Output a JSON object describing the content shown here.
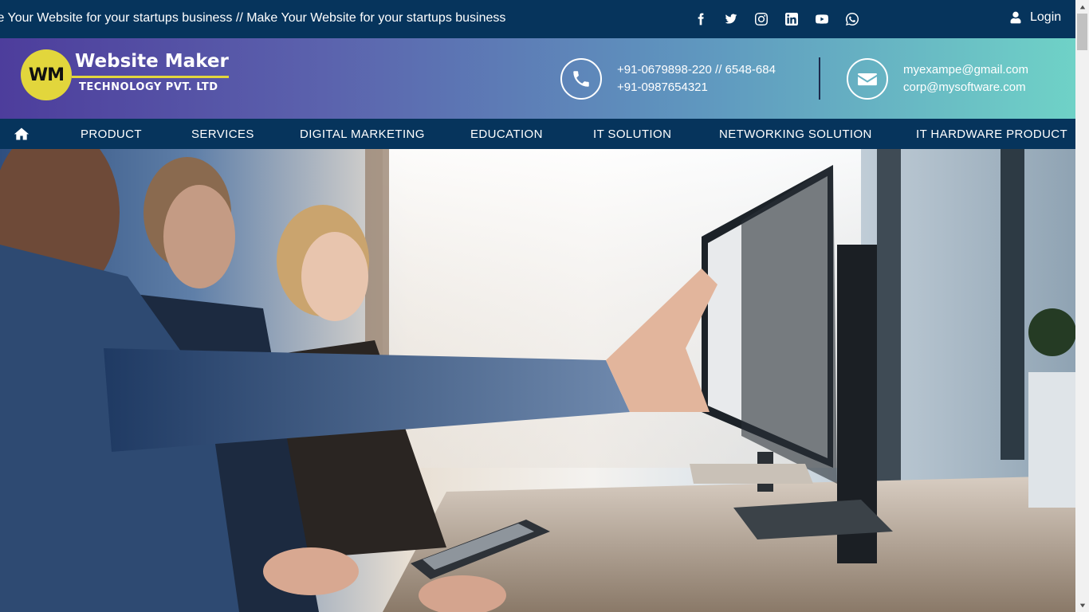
{
  "topbar": {
    "marquee": ":e Your Website for your startups business // Make Your Website for your startups business",
    "socials": [
      "facebook-icon",
      "twitter-icon",
      "instagram-icon",
      "linkedin-icon",
      "youtube-icon",
      "whatsapp-icon"
    ],
    "login_label": "Login"
  },
  "header": {
    "logo_initials": "WM",
    "logo_title": "Website Maker",
    "logo_subtitle": "TECHNOLOGY PVT. LTD",
    "phone_line1": "+91-0679898-220 // 6548-684",
    "phone_line2": "+91-0987654321",
    "email_line1": "myexampe@gmail.com",
    "email_line2": "corp@mysoftware.com"
  },
  "nav": {
    "items": [
      {
        "label": "PRODUCT"
      },
      {
        "label": "SERVICES"
      },
      {
        "label": "DIGITAL MARKETING"
      },
      {
        "label": "EDUCATION"
      },
      {
        "label": "IT SOLUTION"
      },
      {
        "label": "NETWORKING SOLUTION"
      },
      {
        "label": "IT HARDWARE PRODUCT"
      }
    ]
  },
  "colors": {
    "topbar_bg": "#06345c",
    "header_gradient_start": "#4d3d9c",
    "header_gradient_end": "#6fd2c7",
    "logo_accent": "#e2d63c"
  }
}
